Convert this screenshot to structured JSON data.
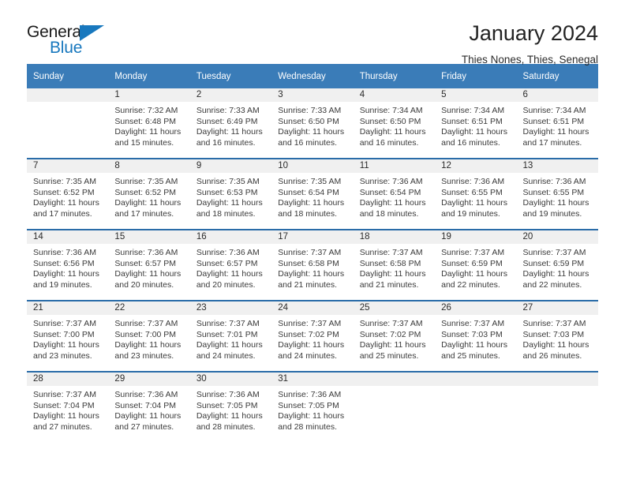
{
  "brand": {
    "name_top": "General",
    "name_bottom": "Blue",
    "accent_color": "#1878be"
  },
  "header": {
    "title": "January 2024",
    "subtitle": "Thies Nones, Thies, Senegal"
  },
  "theme": {
    "header_blue": "#3a7cb8",
    "divider_blue": "#2a6ca8",
    "daynum_band": "#f0f0f0"
  },
  "weekday_headers": [
    "Sunday",
    "Monday",
    "Tuesday",
    "Wednesday",
    "Thursday",
    "Friday",
    "Saturday"
  ],
  "weeks": [
    [
      {
        "day": "",
        "empty": true,
        "sunrise": "",
        "sunset": "",
        "daylight1": "",
        "daylight2": ""
      },
      {
        "day": "1",
        "empty": false,
        "sunrise": "Sunrise: 7:32 AM",
        "sunset": "Sunset: 6:48 PM",
        "daylight1": "Daylight: 11 hours",
        "daylight2": "and 15 minutes."
      },
      {
        "day": "2",
        "empty": false,
        "sunrise": "Sunrise: 7:33 AM",
        "sunset": "Sunset: 6:49 PM",
        "daylight1": "Daylight: 11 hours",
        "daylight2": "and 16 minutes."
      },
      {
        "day": "3",
        "empty": false,
        "sunrise": "Sunrise: 7:33 AM",
        "sunset": "Sunset: 6:50 PM",
        "daylight1": "Daylight: 11 hours",
        "daylight2": "and 16 minutes."
      },
      {
        "day": "4",
        "empty": false,
        "sunrise": "Sunrise: 7:34 AM",
        "sunset": "Sunset: 6:50 PM",
        "daylight1": "Daylight: 11 hours",
        "daylight2": "and 16 minutes."
      },
      {
        "day": "5",
        "empty": false,
        "sunrise": "Sunrise: 7:34 AM",
        "sunset": "Sunset: 6:51 PM",
        "daylight1": "Daylight: 11 hours",
        "daylight2": "and 16 minutes."
      },
      {
        "day": "6",
        "empty": false,
        "sunrise": "Sunrise: 7:34 AM",
        "sunset": "Sunset: 6:51 PM",
        "daylight1": "Daylight: 11 hours",
        "daylight2": "and 17 minutes."
      }
    ],
    [
      {
        "day": "7",
        "empty": false,
        "sunrise": "Sunrise: 7:35 AM",
        "sunset": "Sunset: 6:52 PM",
        "daylight1": "Daylight: 11 hours",
        "daylight2": "and 17 minutes."
      },
      {
        "day": "8",
        "empty": false,
        "sunrise": "Sunrise: 7:35 AM",
        "sunset": "Sunset: 6:52 PM",
        "daylight1": "Daylight: 11 hours",
        "daylight2": "and 17 minutes."
      },
      {
        "day": "9",
        "empty": false,
        "sunrise": "Sunrise: 7:35 AM",
        "sunset": "Sunset: 6:53 PM",
        "daylight1": "Daylight: 11 hours",
        "daylight2": "and 18 minutes."
      },
      {
        "day": "10",
        "empty": false,
        "sunrise": "Sunrise: 7:35 AM",
        "sunset": "Sunset: 6:54 PM",
        "daylight1": "Daylight: 11 hours",
        "daylight2": "and 18 minutes."
      },
      {
        "day": "11",
        "empty": false,
        "sunrise": "Sunrise: 7:36 AM",
        "sunset": "Sunset: 6:54 PM",
        "daylight1": "Daylight: 11 hours",
        "daylight2": "and 18 minutes."
      },
      {
        "day": "12",
        "empty": false,
        "sunrise": "Sunrise: 7:36 AM",
        "sunset": "Sunset: 6:55 PM",
        "daylight1": "Daylight: 11 hours",
        "daylight2": "and 19 minutes."
      },
      {
        "day": "13",
        "empty": false,
        "sunrise": "Sunrise: 7:36 AM",
        "sunset": "Sunset: 6:55 PM",
        "daylight1": "Daylight: 11 hours",
        "daylight2": "and 19 minutes."
      }
    ],
    [
      {
        "day": "14",
        "empty": false,
        "sunrise": "Sunrise: 7:36 AM",
        "sunset": "Sunset: 6:56 PM",
        "daylight1": "Daylight: 11 hours",
        "daylight2": "and 19 minutes."
      },
      {
        "day": "15",
        "empty": false,
        "sunrise": "Sunrise: 7:36 AM",
        "sunset": "Sunset: 6:57 PM",
        "daylight1": "Daylight: 11 hours",
        "daylight2": "and 20 minutes."
      },
      {
        "day": "16",
        "empty": false,
        "sunrise": "Sunrise: 7:36 AM",
        "sunset": "Sunset: 6:57 PM",
        "daylight1": "Daylight: 11 hours",
        "daylight2": "and 20 minutes."
      },
      {
        "day": "17",
        "empty": false,
        "sunrise": "Sunrise: 7:37 AM",
        "sunset": "Sunset: 6:58 PM",
        "daylight1": "Daylight: 11 hours",
        "daylight2": "and 21 minutes."
      },
      {
        "day": "18",
        "empty": false,
        "sunrise": "Sunrise: 7:37 AM",
        "sunset": "Sunset: 6:58 PM",
        "daylight1": "Daylight: 11 hours",
        "daylight2": "and 21 minutes."
      },
      {
        "day": "19",
        "empty": false,
        "sunrise": "Sunrise: 7:37 AM",
        "sunset": "Sunset: 6:59 PM",
        "daylight1": "Daylight: 11 hours",
        "daylight2": "and 22 minutes."
      },
      {
        "day": "20",
        "empty": false,
        "sunrise": "Sunrise: 7:37 AM",
        "sunset": "Sunset: 6:59 PM",
        "daylight1": "Daylight: 11 hours",
        "daylight2": "and 22 minutes."
      }
    ],
    [
      {
        "day": "21",
        "empty": false,
        "sunrise": "Sunrise: 7:37 AM",
        "sunset": "Sunset: 7:00 PM",
        "daylight1": "Daylight: 11 hours",
        "daylight2": "and 23 minutes."
      },
      {
        "day": "22",
        "empty": false,
        "sunrise": "Sunrise: 7:37 AM",
        "sunset": "Sunset: 7:00 PM",
        "daylight1": "Daylight: 11 hours",
        "daylight2": "and 23 minutes."
      },
      {
        "day": "23",
        "empty": false,
        "sunrise": "Sunrise: 7:37 AM",
        "sunset": "Sunset: 7:01 PM",
        "daylight1": "Daylight: 11 hours",
        "daylight2": "and 24 minutes."
      },
      {
        "day": "24",
        "empty": false,
        "sunrise": "Sunrise: 7:37 AM",
        "sunset": "Sunset: 7:02 PM",
        "daylight1": "Daylight: 11 hours",
        "daylight2": "and 24 minutes."
      },
      {
        "day": "25",
        "empty": false,
        "sunrise": "Sunrise: 7:37 AM",
        "sunset": "Sunset: 7:02 PM",
        "daylight1": "Daylight: 11 hours",
        "daylight2": "and 25 minutes."
      },
      {
        "day": "26",
        "empty": false,
        "sunrise": "Sunrise: 7:37 AM",
        "sunset": "Sunset: 7:03 PM",
        "daylight1": "Daylight: 11 hours",
        "daylight2": "and 25 minutes."
      },
      {
        "day": "27",
        "empty": false,
        "sunrise": "Sunrise: 7:37 AM",
        "sunset": "Sunset: 7:03 PM",
        "daylight1": "Daylight: 11 hours",
        "daylight2": "and 26 minutes."
      }
    ],
    [
      {
        "day": "28",
        "empty": false,
        "sunrise": "Sunrise: 7:37 AM",
        "sunset": "Sunset: 7:04 PM",
        "daylight1": "Daylight: 11 hours",
        "daylight2": "and 27 minutes."
      },
      {
        "day": "29",
        "empty": false,
        "sunrise": "Sunrise: 7:36 AM",
        "sunset": "Sunset: 7:04 PM",
        "daylight1": "Daylight: 11 hours",
        "daylight2": "and 27 minutes."
      },
      {
        "day": "30",
        "empty": false,
        "sunrise": "Sunrise: 7:36 AM",
        "sunset": "Sunset: 7:05 PM",
        "daylight1": "Daylight: 11 hours",
        "daylight2": "and 28 minutes."
      },
      {
        "day": "31",
        "empty": false,
        "sunrise": "Sunrise: 7:36 AM",
        "sunset": "Sunset: 7:05 PM",
        "daylight1": "Daylight: 11 hours",
        "daylight2": "and 28 minutes."
      },
      {
        "day": "",
        "empty": true,
        "sunrise": "",
        "sunset": "",
        "daylight1": "",
        "daylight2": ""
      },
      {
        "day": "",
        "empty": true,
        "sunrise": "",
        "sunset": "",
        "daylight1": "",
        "daylight2": ""
      },
      {
        "day": "",
        "empty": true,
        "sunrise": "",
        "sunset": "",
        "daylight1": "",
        "daylight2": ""
      }
    ]
  ]
}
